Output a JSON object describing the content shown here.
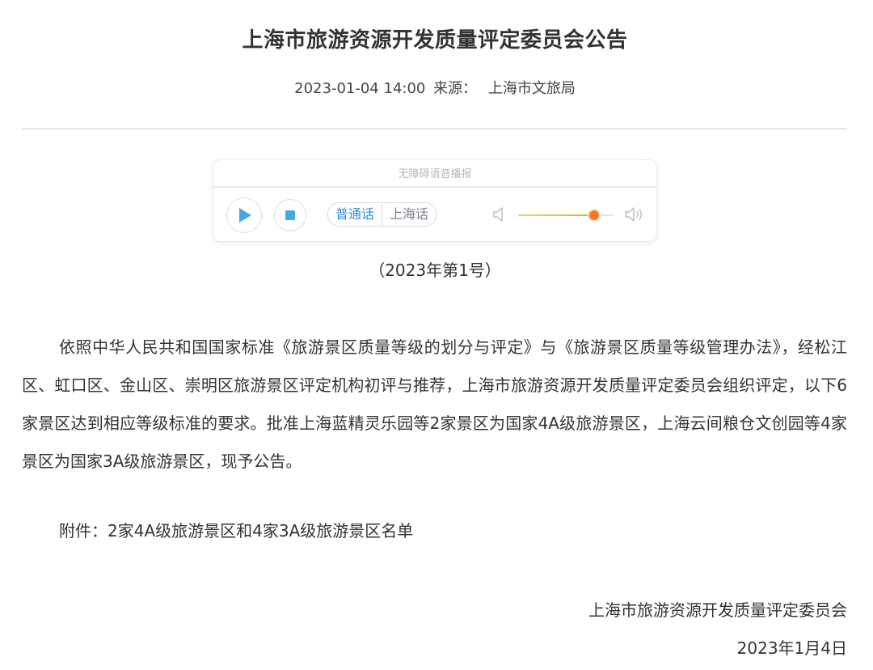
{
  "article": {
    "title": "上海市旅游资源开发质量评定委员会公告",
    "datetime": "2023-01-04 14:00",
    "source_label": "来源：",
    "source_value": "上海市文旅局",
    "doc_number": "（2023年第1号）",
    "body": "依照中华人民共和国国家标准《旅游景区质量等级的划分与评定》与《旅游景区质量等级管理办法》，经松江区、虹口区、金山区、崇明区旅游景区评定机构初评与推荐，上海市旅游资源开发质量评定委员会组织评定，以下6家景区达到相应等级标准的要求。批准上海蓝精灵乐园等2家景区为国家4A级旅游景区，上海云间粮仓文创园等4家景区为国家3A级旅游景区，现予公告。",
    "attachment": "附件：2家4A级旅游景区和4家3A级旅游景区名单",
    "signature_org": "上海市旅游资源开发质量评定委员会",
    "signature_date": "2023年1月4日"
  },
  "audio_player": {
    "header": "无障碍语音播报",
    "dialects": [
      "普通话",
      "上海话"
    ],
    "active_dialect": "普通话",
    "progress": 0.0,
    "volume": 0.8,
    "icons": [
      "play-icon",
      "stop-icon",
      "volume-low-icon",
      "volume-high-icon"
    ],
    "accent_color": "#4aa3e0",
    "volume_color": "#f07b1e"
  }
}
